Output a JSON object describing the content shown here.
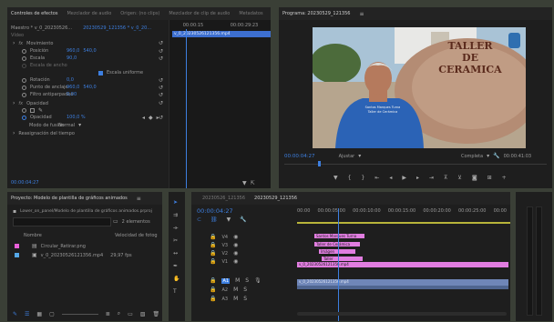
{
  "effects": {
    "tabs": [
      "Controles de efectos",
      "Mezclador de audio",
      "Origen: (no clips)",
      "Mezclador de clip de audio",
      "Metadatos"
    ],
    "header": "Maestro * v_0_20230526...",
    "source_tab": "20230529_121356 * v_0_20...",
    "section": "Vídeo",
    "movement": "Movimiento",
    "position_label": "Posición",
    "position_x": "960,0",
    "position_y": "540,0",
    "scale_label": "Escala",
    "scale_value": "90,0",
    "scale_width_label": "Escala de ancho",
    "uniform_label": "Escala uniforme",
    "rotation_label": "Rotación",
    "rotation_value": "0,0",
    "anchor_label": "Punto de anclaje",
    "anchor_x": "960,0",
    "anchor_y": "540,0",
    "flicker_label": "Filtro antiparpadeo",
    "flicker_value": "0,00",
    "opacity": "Opacidad",
    "opacity_label": "Opacidad",
    "opacity_value": "100,0 %",
    "blend_label": "Modo de fusión",
    "blend_value": "Normal",
    "remap_label": "Reasignación del tiempo",
    "mini_clip_name": "v_0_20230526121356.mp4",
    "mini_time1": "00:00:15",
    "mini_time2": "00:00:29:23",
    "bottom_time": "00:00:04:27"
  },
  "program": {
    "tab": "Programa: 20230529_121356",
    "sign_line1": "TALLER",
    "sign_line2": "DE",
    "sign_line3": "CERAMICA",
    "shirt_line1": "Santos Marques Turna",
    "shirt_line2": "Taller de Cerámica",
    "timecode": "00:00:04:27",
    "fit": "Ajustar",
    "quality": "Completa",
    "duration": "00:00:41:03"
  },
  "project": {
    "tab": "Proyecto: Modelo de plantilla de gráficos animados",
    "path": "Lower_on_panel/Modelo de plantilla de gráficos animados.prproj",
    "items_count": "2 elementos",
    "col_name": "Nombre",
    "col_fps": "Velocidad de fotog",
    "items": [
      {
        "name": "Circular_Retirar.png",
        "fps": "",
        "color": "#e95fd9"
      },
      {
        "name": "v_0_20230526121356.mp4",
        "fps": "29,97 fps",
        "color": "#55a8e8"
      }
    ]
  },
  "timeline": {
    "tab1": "20230526_121356",
    "tab2": "20230529_121356",
    "timecode": "00:00:04:27",
    "ruler": [
      "00:00",
      "00:00:05:00",
      "00:00:10:00",
      "00:00:15:00",
      "00:00:20:00",
      "00:00:25:00",
      "00:00"
    ],
    "tracks": [
      "V4",
      "V3",
      "V2",
      "V1",
      "A1",
      "A2",
      "A3"
    ],
    "clips": [
      {
        "label": "Santos Marques Turna",
        "color": "#e17de0"
      },
      {
        "label": "Taller de Cerámica",
        "color": "#e17de0"
      },
      {
        "label": "Imágen",
        "color": "#e17de0"
      },
      {
        "label": "Taller",
        "color": "#e17de0"
      },
      {
        "label": "v_0_20230526121356.mp4",
        "color": "#e17de0"
      },
      {
        "label": "v_0_20230526121356.mp4",
        "color": "#6f86b8"
      }
    ]
  }
}
